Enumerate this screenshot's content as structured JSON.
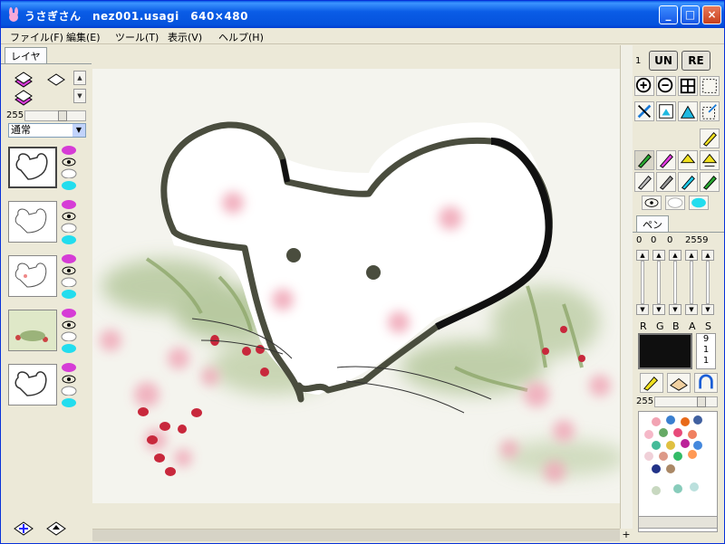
{
  "window": {
    "title": "うさぎさん　nez001.usagi　640×480",
    "controls": {
      "minimize": "_",
      "maximize": "□",
      "close": "×"
    }
  },
  "menu": [
    {
      "label": "ファイル(F)"
    },
    {
      "label": "編集(E)"
    },
    {
      "label": "ツール(T)"
    },
    {
      "label": "表示(V)"
    },
    {
      "label": "ヘルプ(H)"
    }
  ],
  "left_panel": {
    "tab_label": "レイヤ",
    "opacity_value": "255",
    "blend_mode": "通常",
    "layers": [
      {
        "name": "layer-1",
        "selected": true
      },
      {
        "name": "layer-2",
        "selected": false
      },
      {
        "name": "layer-3",
        "selected": false
      },
      {
        "name": "layer-4",
        "selected": false
      },
      {
        "name": "layer-5",
        "selected": false
      }
    ]
  },
  "right_panel": {
    "history_index": "1",
    "undo_label": "UN",
    "redo_label": "RE",
    "brush_tab_label": "ペン",
    "brush_values": [
      "0",
      "0",
      "0",
      "2559"
    ],
    "channels": [
      "R",
      "G",
      "B",
      "A",
      "S"
    ],
    "current_color": "#0f0f0f",
    "side_values": [
      "9",
      "1",
      "1"
    ],
    "palette_opacity": "255",
    "palette_colors": [
      "#f2a3b3",
      "#3a7fd0",
      "#e86a1a",
      "#4060a0",
      "#f5b8c8",
      "#66aa66",
      "#e84a7a",
      "#f08060",
      "#44bb99",
      "#e0c040",
      "#bb2299",
      "#4488dd",
      "#f0d0d8",
      "#dd9988",
      "#33bb66",
      "#ff9955",
      "#223388",
      "#aa8866",
      "#c8d8c0",
      "#88ccbb",
      "#bbe0dd"
    ]
  },
  "icons": {
    "app": "rabbit-icon",
    "zoom_in": "zoom-in-icon",
    "zoom_out": "zoom-out-icon"
  }
}
